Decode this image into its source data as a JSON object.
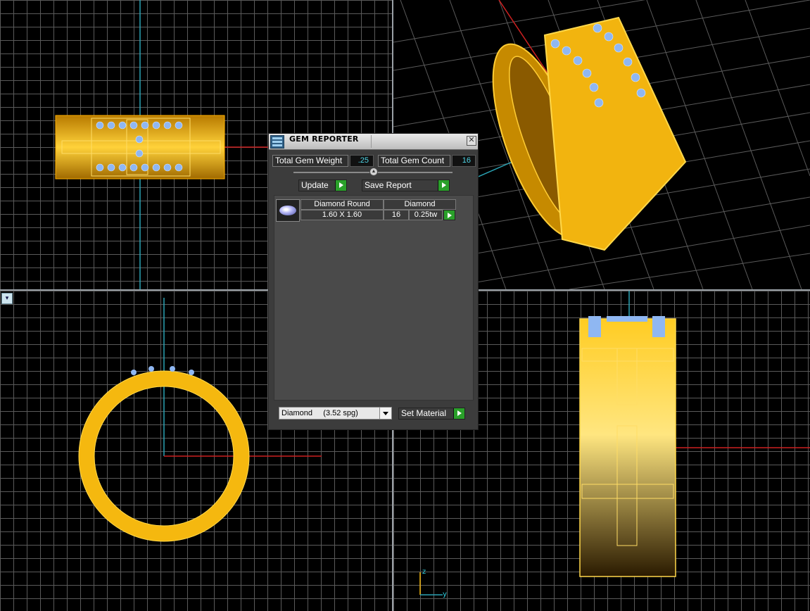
{
  "panel": {
    "title": "GEM REPORTER",
    "total_weight_label": "Total Gem Weight",
    "total_weight_value": ".25",
    "total_count_label": "Total Gem Count",
    "total_count_value": "16",
    "update_label": "Update",
    "save_report_label": "Save Report",
    "gems": [
      {
        "name": "Diamond Round",
        "material": "Diamond",
        "size": "1.60 X 1.60",
        "count": "16",
        "weight": "0.25tw"
      }
    ],
    "material_select": "Diamond     (3.52 spg)",
    "set_material_label": "Set Material"
  },
  "viewport_axes": {
    "z": "z",
    "y": "y"
  },
  "colors": {
    "gold": "#f5b80f",
    "gem": "#8fb7f2",
    "axis_red": "#cc2020",
    "axis_cyan": "#2aa3b4",
    "value_text": "#4fd5e6",
    "go_green": "#2aa02a"
  }
}
